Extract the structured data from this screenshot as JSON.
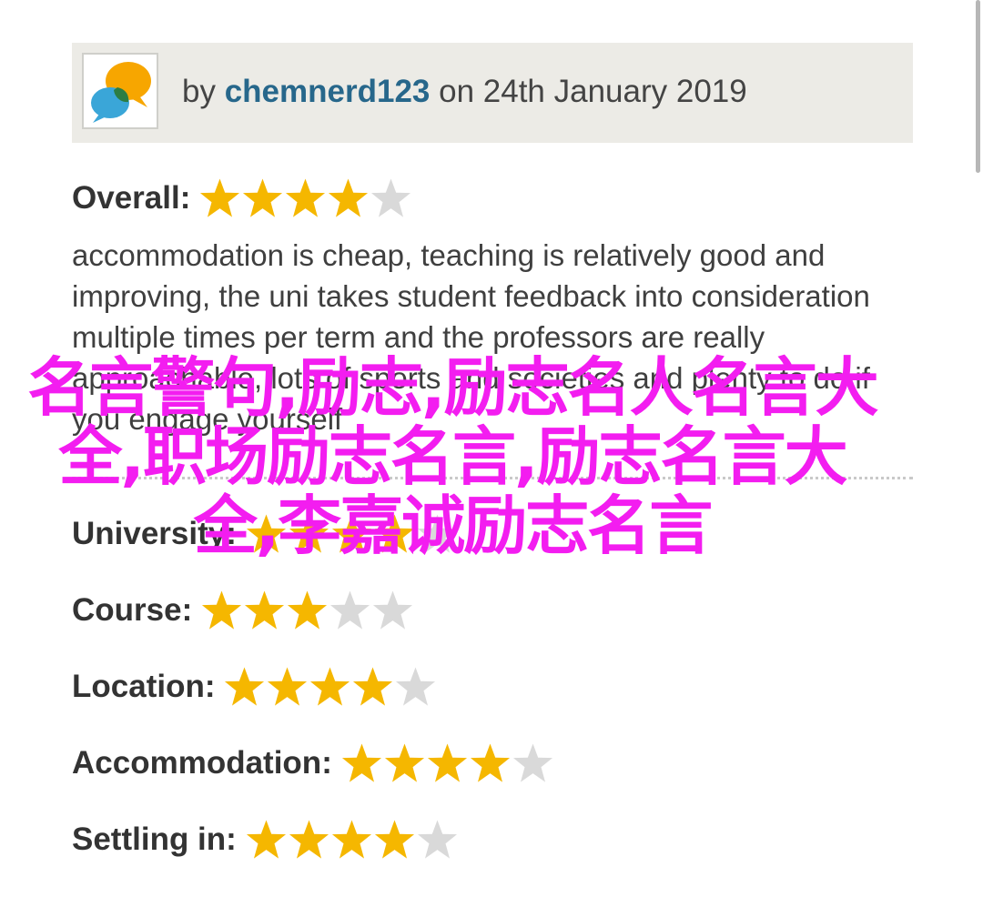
{
  "review": {
    "by_label": "by",
    "author": "chemnerd123",
    "date_text": "on 24th January 2019",
    "avatar_icon": "speech-bubbles-icon",
    "text": "accommodation is cheap, teaching is relatively good and improving, the uni takes student feedback into consideration multiple times per term and the professors are really approachable, lots of sports and societies and plenty to do if you engage yourself"
  },
  "ratings": [
    {
      "label": "Overall:",
      "stars": 4,
      "max": 5
    },
    {
      "label": "University:",
      "stars": 4,
      "max": 5
    },
    {
      "label": "Course:",
      "stars": 3,
      "max": 5
    },
    {
      "label": "Location:",
      "stars": 4,
      "max": 5
    },
    {
      "label": "Accommodation:",
      "stars": 4,
      "max": 5
    },
    {
      "label": "Settling in:",
      "stars": 4,
      "max": 5
    }
  ],
  "overlay_text": "名言警句,励志,励志名人名言大全,职场励志名言,励志名言大全,李嘉诚励志名言",
  "colors": {
    "star_filled": "#f5b700",
    "star_empty": "#d9d9d9",
    "author": "#27678b",
    "overlay": "#f31df0",
    "header_bg": "#ecebe6"
  }
}
